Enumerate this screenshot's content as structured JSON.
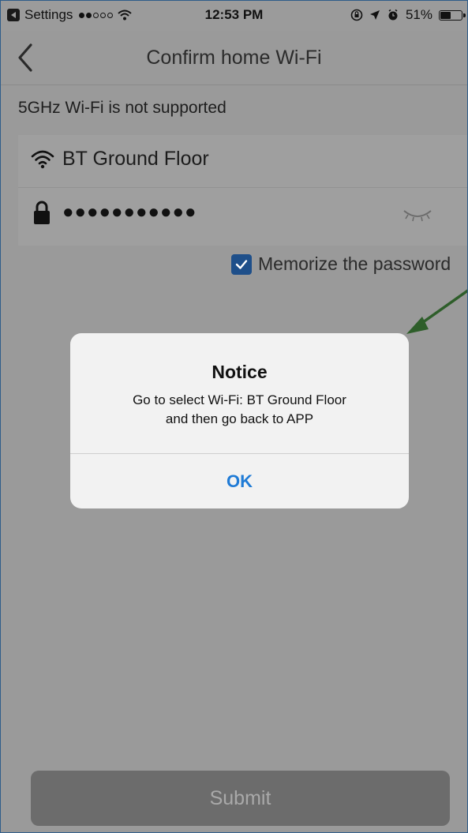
{
  "status_bar": {
    "carrier": "Settings",
    "time": "12:53 PM",
    "battery": "51%",
    "battery_level": 0.51
  },
  "nav": {
    "title": "Confirm home Wi-Fi",
    "back_icon": "chevron-left-icon"
  },
  "warning": "5GHz Wi-Fi is not supported",
  "form": {
    "ssid": "BT Ground Floor",
    "password_mask": "●●●●●●●●●●●",
    "memorize_label": "Memorize the password",
    "memorize_checked": true
  },
  "dialog": {
    "title": "Notice",
    "message_line1": "Go to select Wi-Fi: BT Ground Floor",
    "message_line2": "and then go back to APP",
    "ok_label": "OK"
  },
  "submit_label": "Submit",
  "colors": {
    "accent_blue": "#1f7bd6",
    "checkbox": "#1e4f8a",
    "annotation_arrow": "#2e5e2a"
  }
}
